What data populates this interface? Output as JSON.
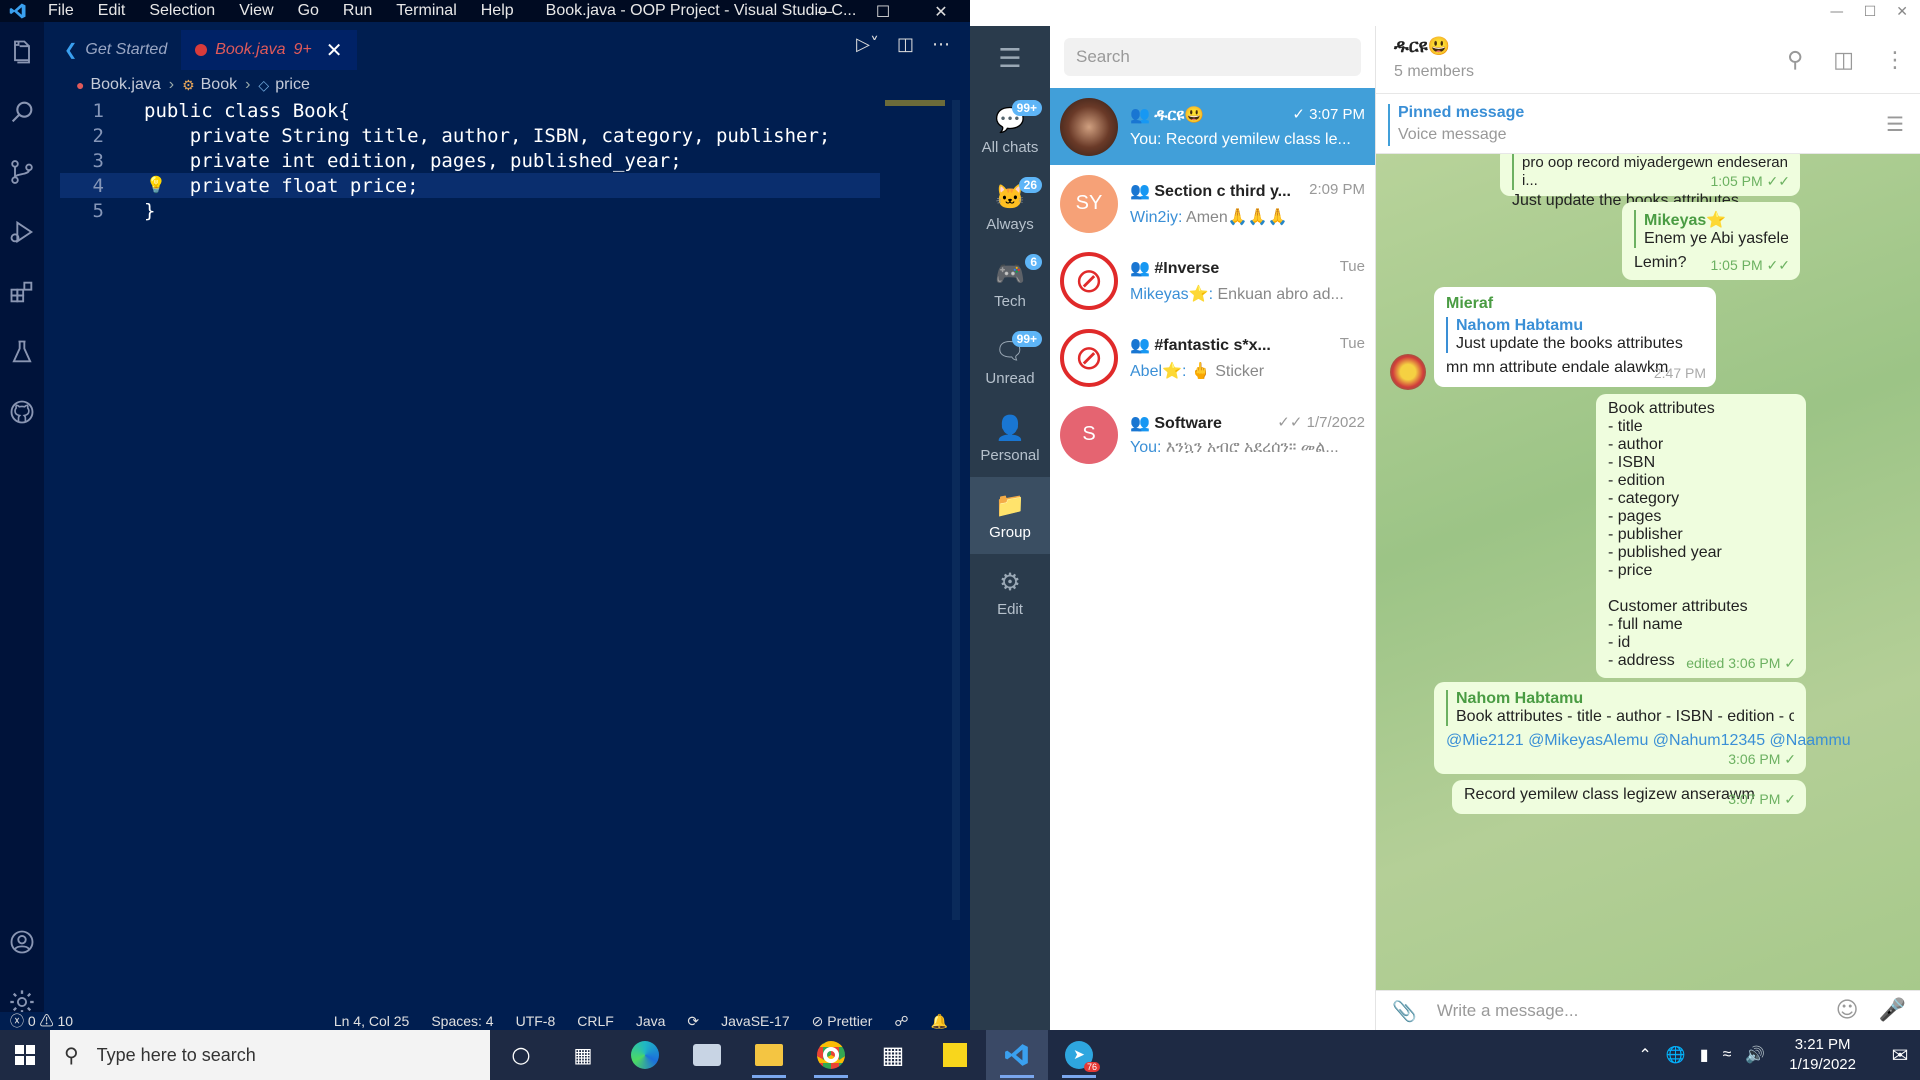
{
  "vscode": {
    "menu": [
      "File",
      "Edit",
      "Selection",
      "View",
      "Go",
      "Run",
      "Terminal",
      "Help"
    ],
    "window_title": "Book.java - OOP Project - Visual Studio C...",
    "tabs": [
      {
        "label": "Get Started"
      },
      {
        "label": "Book.java",
        "badge": "9+"
      }
    ],
    "breadcrumb": [
      "Book.java",
      "Book",
      "price"
    ],
    "code": [
      {
        "n": "1",
        "text": "public class Book{"
      },
      {
        "n": "2",
        "text": "    private String title, author, ISBN, category, publisher;"
      },
      {
        "n": "3",
        "text": "    private int edition, pages, published_year;"
      },
      {
        "n": "4",
        "text": "    private float price;"
      },
      {
        "n": "5",
        "text": "}"
      }
    ],
    "status": {
      "problems": "ⓧ 0 ⚠ 10",
      "position": "Ln 4, Col 25",
      "spaces": "Spaces: 4",
      "encoding": "UTF-8",
      "eol": "CRLF",
      "language": "Java",
      "jdk": "JavaSE-17",
      "prettier": "⊘ Prettier"
    }
  },
  "telegram": {
    "search_placeholder": "Search",
    "folders": [
      {
        "label": "All chats",
        "count": "99+"
      },
      {
        "label": "Always",
        "count": "26"
      },
      {
        "label": "Tech",
        "count": "6"
      },
      {
        "label": "Unread",
        "count": "99+"
      },
      {
        "label": "Personal",
        "count": ""
      },
      {
        "label": "Group",
        "count": ""
      },
      {
        "label": "Edit",
        "count": ""
      }
    ],
    "chats": [
      {
        "name": "ዱርዩ😃",
        "time": "✓ 3:07 PM",
        "who": "You:",
        "preview": " Record yemilew class le...",
        "avatar_text": "",
        "avatar_color": "#5a3a2a"
      },
      {
        "name": "Section c third y...",
        "time": "2:09 PM",
        "who": "Win2iy:",
        "preview": " Amen🙏🙏🙏",
        "avatar_text": "SY",
        "avatar_color": "#f6a177"
      },
      {
        "name": "#Inverse",
        "time": "Tue",
        "who": "Mikeyas⭐:",
        "preview": " Enkuan abro ad...",
        "avatar_text": "",
        "avatar_color": "#ffffff"
      },
      {
        "name": "#fantastic s*x...",
        "time": "Tue",
        "who": "Abel⭐:",
        "preview": " 🖕 Sticker",
        "avatar_text": "",
        "avatar_color": "#ffffff"
      },
      {
        "name": "Software",
        "time": "✓✓ 1/7/2022",
        "who": "You:",
        "preview": " እንኳን አብሮ አደረሰን። መል...",
        "avatar_text": "S",
        "avatar_color": "#e56471"
      }
    ],
    "chat_header": {
      "title": "ዱርዩ😃",
      "subtitle": "5 members"
    },
    "pinned": {
      "title": "Pinned message",
      "text": "Voice message"
    },
    "messages": {
      "m1_top": "pro oop record miyadergewn endeseran i...",
      "m1_text": "Just update the books attributes",
      "m1_time": "1:05 PM ✓✓",
      "m2_sender": "Mikeyas⭐",
      "m2_quote": "Enem ye Abi yasfelege...",
      "m2_text": "Lemin?",
      "m2_time": "1:05 PM ✓✓",
      "m3_sender": "Mieraf",
      "m3_qname": "Nahom Habtamu",
      "m3_qtext": "Just update the books attributes",
      "m3_text": "mn mn attribute endale alawkm",
      "m3_time": "2:47 PM",
      "m4_lines": [
        "Book attributes",
        "- title",
        "- author",
        "- ISBN",
        "- edition",
        "- category",
        "- pages",
        "- publisher",
        "- published year",
        "- price",
        "",
        "Customer attributes",
        "- full name",
        "- id",
        "- address"
      ],
      "m4_time": "edited 3:06 PM ✓",
      "m5_qname": "Nahom Habtamu",
      "m5_qtext": "Book attributes - title - author  - ISBN - edition - categ...",
      "m5_text": "@Mie2121 @MikeyasAlemu @Nahum12345 @Naammu",
      "m5_time": "3:06 PM ✓",
      "m6_text": "Record yemilew class legizew anserawm",
      "m6_time": "3:07 PM ✓"
    },
    "compose_placeholder": "Write a message..."
  },
  "taskbar": {
    "search_placeholder": "Type here to search",
    "time": "3:21 PM",
    "date": "1/19/2022",
    "telegram_badge": "76"
  }
}
